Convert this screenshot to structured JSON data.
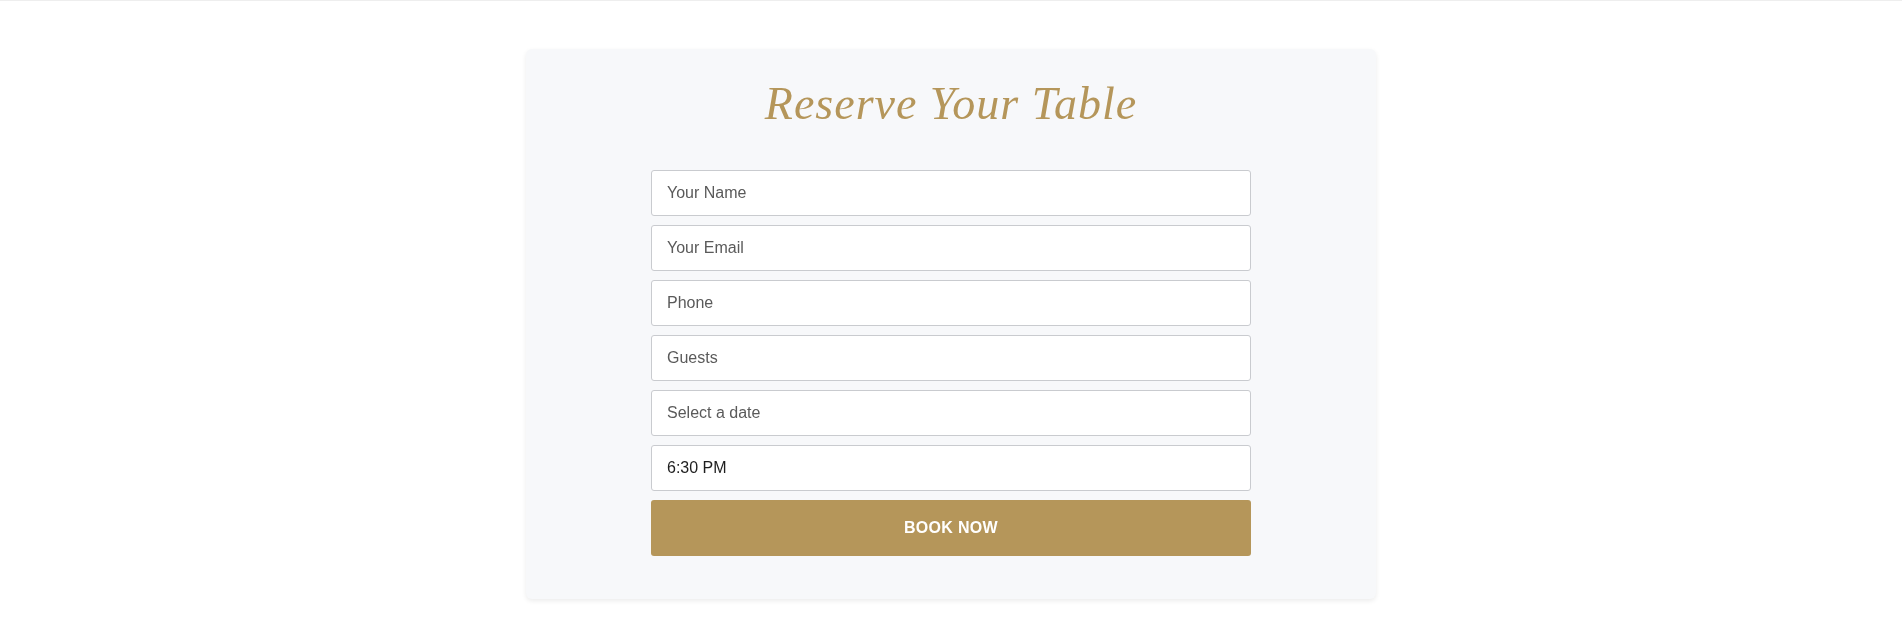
{
  "title": "Reserve Your Table",
  "fields": [
    {
      "placeholder": "Your Name"
    },
    {
      "placeholder": "Your Email"
    },
    {
      "placeholder": "Phone"
    },
    {
      "placeholder": "Guests"
    },
    {
      "placeholder": "Select a date"
    },
    {
      "value": "6:30 PM"
    }
  ],
  "submit": {
    "label": "BOOK NOW"
  }
}
